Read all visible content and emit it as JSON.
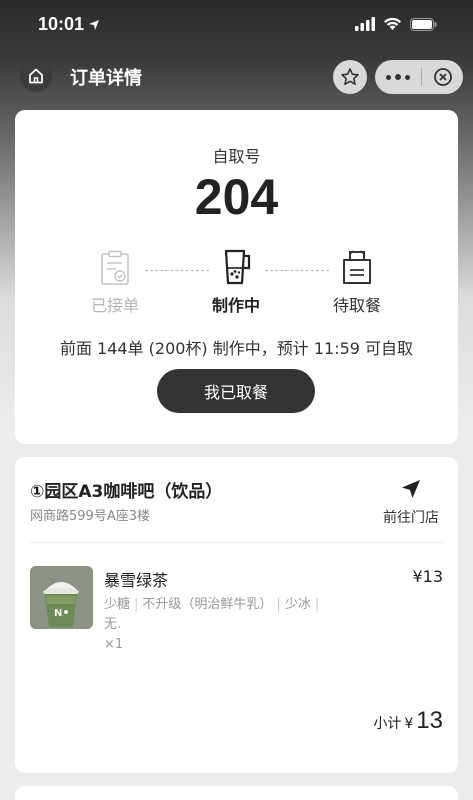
{
  "status_bar": {
    "time": "10:01"
  },
  "nav": {
    "title": "订单详情"
  },
  "pickup": {
    "label": "自取号",
    "number": "204",
    "steps": [
      {
        "label": "已接单"
      },
      {
        "label": "制作中"
      },
      {
        "label": "待取餐"
      }
    ],
    "queue_text": "前面 144单 (200杯) 制作中，预计 11:59 可自取",
    "picked_button": "我已取餐"
  },
  "store": {
    "name": "①园区A3咖啡吧（饮品）",
    "address": "网商路599号A座3楼",
    "navigate_label": "前往门店"
  },
  "order_item": {
    "name": "暴雪绿茶",
    "price": "¥13",
    "specs": [
      "少糖",
      "不升级（明治鲜牛乳）",
      "少冰",
      "无."
    ],
    "quantity": "×1"
  },
  "subtotal": {
    "label": "小计",
    "currency": "¥",
    "amount": "13"
  }
}
